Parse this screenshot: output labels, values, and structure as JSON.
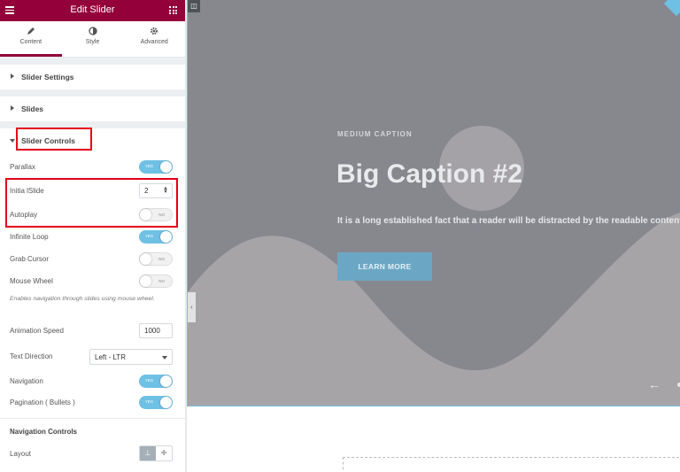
{
  "panel": {
    "title": "Edit Slider",
    "tabs": [
      {
        "label": "Content",
        "icon": "pencil-icon"
      },
      {
        "label": "Style",
        "icon": "contrast-icon"
      },
      {
        "label": "Advanced",
        "icon": "gear-icon"
      }
    ],
    "sections": {
      "slider_settings": "Slider Settings",
      "slides": "Slides",
      "slider_controls": "Slider Controls"
    },
    "controls": {
      "parallax": {
        "label": "Parallax",
        "state": "YES"
      },
      "initial_slide": {
        "label": "Initia lSlide",
        "value": "2"
      },
      "autoplay": {
        "label": "Autoplay",
        "state": "NO"
      },
      "infinite_loop": {
        "label": "Infinite Loop",
        "state": "YES"
      },
      "grab_cursor": {
        "label": "Grab Cursor",
        "state": "NO"
      },
      "mouse_wheel": {
        "label": "Mouse Wheel",
        "state": "NO"
      },
      "mouse_wheel_desc": "Enables navigation through slides using mouse wheel.",
      "animation_speed": {
        "label": "Animation Speed",
        "value": "1000"
      },
      "text_direction": {
        "label": "Text Direction",
        "value": "Left - LTR"
      },
      "navigation": {
        "label": "Navigation",
        "state": "YES"
      },
      "pagination": {
        "label": "Pagination ( Bullets )",
        "state": "YES"
      }
    },
    "nav_controls_heading": "Navigation Controls",
    "layout_label": "Layout"
  },
  "preview": {
    "medium_caption": "MEDIUM CAPTION",
    "big_caption": "Big Caption #2",
    "description": "It is a long established fact that a reader will be distracted by the readable content",
    "button": "LEARN MORE"
  },
  "colors": {
    "brand": "#93003a",
    "toggle_green": "#61ce70",
    "toggle_blue": "#6ec1e4",
    "highlight_red": "#e3001b",
    "slide_bg": "#86888e"
  }
}
